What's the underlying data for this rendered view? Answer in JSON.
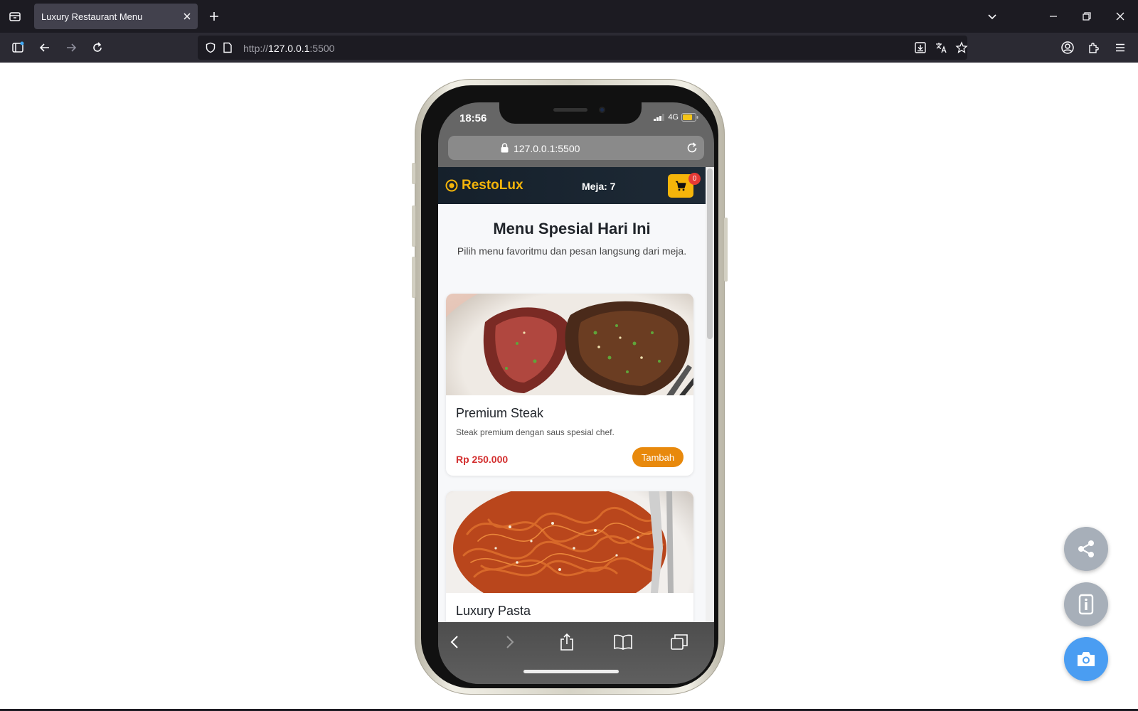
{
  "browser": {
    "tab_title": "Luxury Restaurant Menu",
    "url_scheme": "http://",
    "url_host": "127.0.0.1",
    "url_port": ":5500"
  },
  "phone": {
    "status_time": "18:56",
    "network": "4G",
    "address": "127.0.0.1:5500"
  },
  "site": {
    "brand": "RestoLux",
    "table": "Meja: 7",
    "cart_count": "0",
    "hero_title": "Menu Spesial Hari Ini",
    "hero_subtitle": "Pilih menu favoritmu dan pesan langsung dari meja.",
    "items": [
      {
        "name": "Premium Steak",
        "description": "Steak premium dengan saus spesial chef.",
        "price": "Rp 250.000",
        "add_label": "Tambah"
      },
      {
        "name": "Luxury Pasta"
      }
    ]
  },
  "colors": {
    "accent": "#f5b50a",
    "price": "#d32f2f",
    "add_button": "#e8890c",
    "fab_primary": "#4a9df2",
    "fab_secondary": "#a7afb9"
  }
}
